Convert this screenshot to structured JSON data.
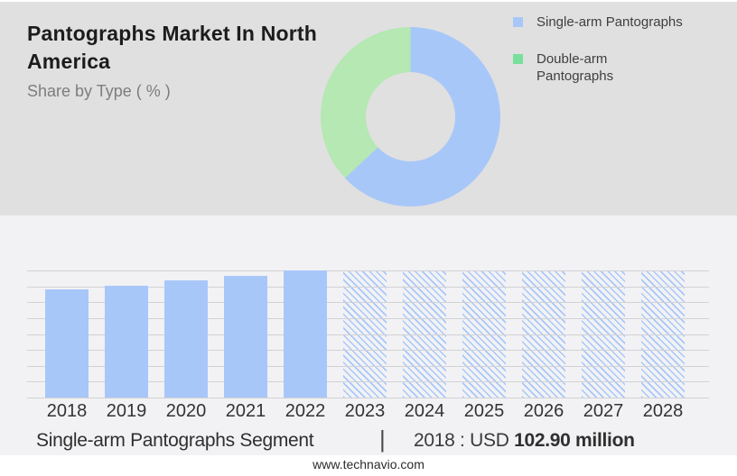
{
  "header": {
    "title": "Pantographs Market In North America",
    "subtitle": "Share by Type ( % )"
  },
  "legend": {
    "items": [
      {
        "label": "Single-arm Pantographs",
        "swatch_color": "#a8c7f9"
      },
      {
        "label": "Double-arm Pantographs",
        "swatch_color": "#79e09c"
      }
    ]
  },
  "chart_data": [
    {
      "type": "pie",
      "donut": true,
      "title": "Share by Type ( % )",
      "legend_position": "right",
      "slices": [
        {
          "label": "Single-arm Pantographs",
          "value": 63,
          "color": "#a8c7f9"
        },
        {
          "label": "Double-arm Pantographs",
          "value": 37,
          "color": "#b5e8b3"
        }
      ]
    },
    {
      "type": "bar",
      "categories": [
        "2018",
        "2019",
        "2020",
        "2021",
        "2022",
        "2023",
        "2024",
        "2025",
        "2026",
        "2027",
        "2028"
      ],
      "values": [
        102.9,
        106.3,
        111.5,
        115.8,
        120.9,
        120.9,
        120.9,
        120.9,
        120.9,
        120.9,
        120.9
      ],
      "values_estimated": true,
      "unit": "USD million",
      "labeled_point": {
        "category": "2018",
        "value": 102.9
      },
      "forecast_from_index": 5,
      "bar_color": "#a8c7f9",
      "forecast_style": "diagonal-hatch",
      "xlabel": "",
      "ylabel": "",
      "ylim": [
        0,
        121
      ],
      "gridline_count": 9,
      "grid": true
    }
  ],
  "caption": {
    "segment": "Single-arm Pantographs Segment",
    "separator": "|",
    "value_prefix": "2018 : USD ",
    "value_bold": "102.90 million"
  },
  "footer": {
    "website": "www.technavio.com"
  },
  "colors": {
    "top_background": "#e0e0e0",
    "chart_background": "#f2f2f4",
    "gridline": "#d2d2d4",
    "accent_blue": "#a8c7f9",
    "accent_green": "#b5e8b3"
  }
}
